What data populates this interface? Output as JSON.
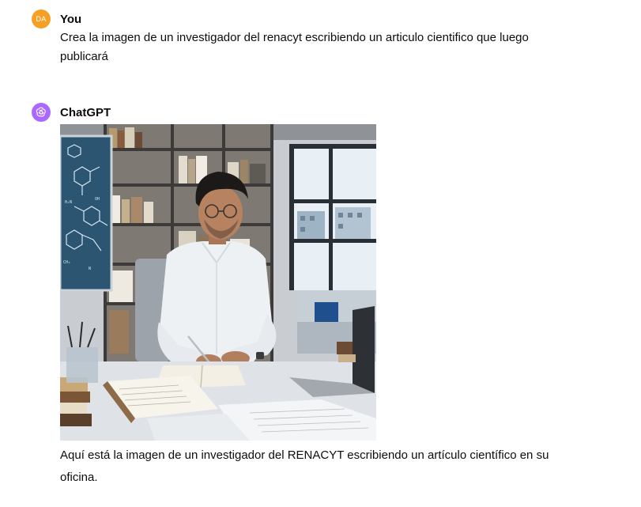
{
  "conversation": {
    "user": {
      "avatar_initials": "DA",
      "avatar_color": "#f4a024",
      "name": "You",
      "message": "Crea la imagen de un investigador del renacyt escribiendo un articulo cientifico que luego publicará"
    },
    "assistant": {
      "avatar_icon": "openai-logo-icon",
      "avatar_color": "#ab68ff",
      "name": "ChatGPT",
      "image_description_icon": "generated-image",
      "reply": "Aquí está la imagen de un investigador del RENACYT escribiendo un artículo científico en su oficina."
    }
  }
}
